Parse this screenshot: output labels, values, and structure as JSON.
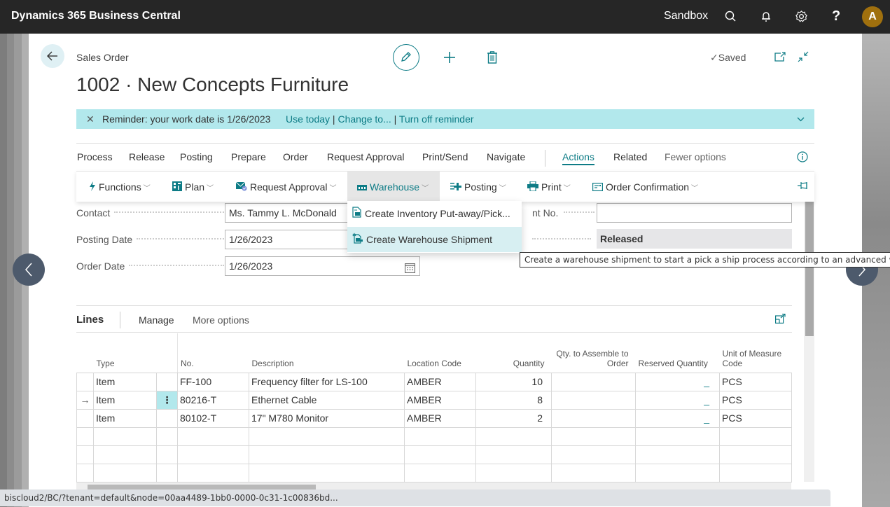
{
  "topbar": {
    "app_title": "Dynamics 365 Business Central",
    "environment": "Sandbox",
    "avatar_initial": "A",
    "avatar_color": "#a0700e"
  },
  "header": {
    "page_kind": "Sales Order",
    "title": "1002 · New Concepts Furniture",
    "saved_label": "Saved"
  },
  "reminder": {
    "message": "Reminder: your work date is 1/26/2023",
    "links": [
      "Use today",
      "Change to...",
      "Turn off reminder"
    ]
  },
  "menubar": {
    "items": [
      "Process",
      "Release",
      "Posting",
      "Prepare",
      "Order",
      "Request Approval",
      "Print/Send",
      "Navigate"
    ],
    "tabs": [
      "Actions",
      "Related",
      "Fewer options"
    ],
    "active_tab": "Actions"
  },
  "ribbon": {
    "buttons": [
      {
        "label": "Functions",
        "icon": "lightning-icon"
      },
      {
        "label": "Plan",
        "icon": "plan-grid-icon"
      },
      {
        "label": "Request Approval",
        "icon": "approval-envelope-icon"
      },
      {
        "label": "Warehouse",
        "icon": "warehouse-icon",
        "open": true
      },
      {
        "label": "Posting",
        "icon": "posting-plus-icon"
      },
      {
        "label": "Print",
        "icon": "printer-icon"
      },
      {
        "label": "Order Confirmation",
        "icon": "document-icon"
      }
    ]
  },
  "warehouse_menu": {
    "items": [
      {
        "label": "Create Inventory Put-away/Pick...",
        "icon": "inventory-document-icon"
      },
      {
        "label": "Create Warehouse Shipment",
        "icon": "warehouse-shipment-icon",
        "highlighted": true
      }
    ]
  },
  "tooltip": "Create a warehouse shipment to start a pick a ship process according to an advanced warehouse configuration.",
  "fields": {
    "contact": {
      "label": "Contact",
      "value": "Ms. Tammy L. McDonald"
    },
    "posting_date": {
      "label": "Posting Date",
      "value": "1/26/2023"
    },
    "order_date": {
      "label": "Order Date",
      "value": "1/26/2023"
    },
    "right_label_partial": "nt No.",
    "external_document_no": "",
    "status": "Released"
  },
  "lines": {
    "title": "Lines",
    "actions": [
      "Manage",
      "More options"
    ],
    "columns": [
      "Type",
      "No.",
      "Description",
      "Location Code",
      "Quantity",
      "Qty. to Assemble to Order",
      "Reserved Quantity",
      "Unit of Measure Code"
    ],
    "rows": [
      {
        "type": "Item",
        "no": "FF-100",
        "description": "Frequency filter for LS-100",
        "location": "AMBER",
        "quantity": "10",
        "qty_assemble": "",
        "reserved": "_",
        "uom": "PCS",
        "current": false
      },
      {
        "type": "Item",
        "no": "80216-T",
        "description": "Ethernet Cable",
        "location": "AMBER",
        "quantity": "8",
        "qty_assemble": "",
        "reserved": "_",
        "uom": "PCS",
        "current": true
      },
      {
        "type": "Item",
        "no": "80102-T",
        "description": "17\" M780 Monitor",
        "location": "AMBER",
        "quantity": "2",
        "qty_assemble": "",
        "reserved": "_",
        "uom": "PCS",
        "current": false
      }
    ],
    "empty_rows": 3
  },
  "statusbar": "biscloud2/BC/?tenant=default&node=00aa4489-1bb0-0000-0c31-1c00836bd...",
  "colors": {
    "accent": "#0e7c86",
    "reminder_bg": "#b2e8ec",
    "topbar_bg": "#262626",
    "nav_button": "#4d5a6c"
  }
}
